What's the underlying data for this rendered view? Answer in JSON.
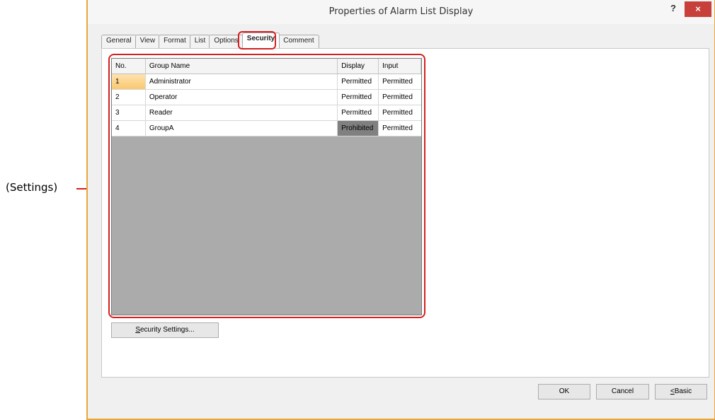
{
  "callout": {
    "label": "(Settings)"
  },
  "dialog": {
    "title": "Properties of Alarm List Display",
    "help_label": "?",
    "close_label": "×"
  },
  "tabs": [
    {
      "label": "General",
      "active": false
    },
    {
      "label": "View",
      "active": false
    },
    {
      "label": "Format",
      "active": false
    },
    {
      "label": "List",
      "active": false
    },
    {
      "label": "Options",
      "active": false
    },
    {
      "label": "Security",
      "active": true
    },
    {
      "label": "Comment",
      "active": false
    }
  ],
  "grid": {
    "headers": [
      "No.",
      "Group Name",
      "Display",
      "Input"
    ],
    "rows": [
      {
        "no": "1",
        "name": "Administrator",
        "display": "Permitted",
        "input": "Permitted"
      },
      {
        "no": "2",
        "name": "Operator",
        "display": "Permitted",
        "input": "Permitted"
      },
      {
        "no": "3",
        "name": "Reader",
        "display": "Permitted",
        "input": "Permitted"
      },
      {
        "no": "4",
        "name": "GroupA",
        "display": "Prohibited",
        "input": "Permitted"
      }
    ]
  },
  "buttons": {
    "security_settings": {
      "mnemonic": "S",
      "rest": "ecurity Settings..."
    },
    "ok": "OK",
    "cancel": "Cancel",
    "basic": {
      "mnemonic": "<",
      "rest": "Basic"
    }
  },
  "colors": {
    "accent_border": "#e8a63a",
    "highlight": "#d42020",
    "close_button": "#c7403a",
    "prohibited_cell": "#808080"
  }
}
